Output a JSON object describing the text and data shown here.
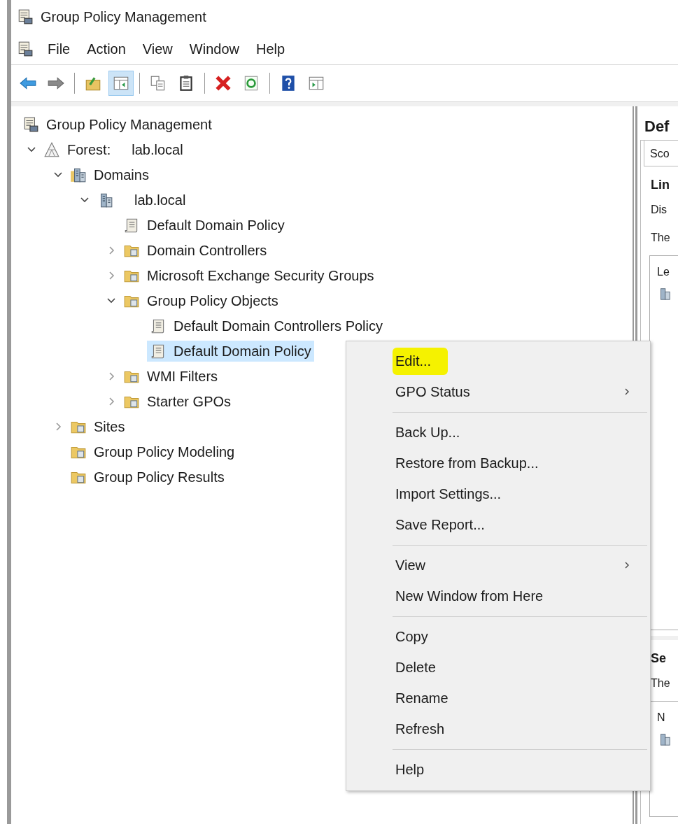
{
  "window": {
    "title": "Group Policy Management"
  },
  "menu_bar": [
    "File",
    "Action",
    "View",
    "Window",
    "Help"
  ],
  "toolbar": [
    {
      "kind": "back",
      "pressed": false
    },
    {
      "kind": "forward",
      "pressed": false
    },
    {
      "kind": "separator"
    },
    {
      "kind": "up",
      "pressed": false
    },
    {
      "kind": "tree-toggle",
      "pressed": true
    },
    {
      "kind": "separator"
    },
    {
      "kind": "copy",
      "pressed": false
    },
    {
      "kind": "paste",
      "pressed": false
    },
    {
      "kind": "separator"
    },
    {
      "kind": "delete",
      "pressed": false
    },
    {
      "kind": "refresh",
      "pressed": false
    },
    {
      "kind": "separator"
    },
    {
      "kind": "help",
      "pressed": false
    },
    {
      "kind": "action-pane",
      "pressed": false
    }
  ],
  "tree": [
    {
      "label": "Group Policy Management",
      "kind": "console",
      "selected": false,
      "children": [
        {
          "label": "Forest:",
          "name": "lab.local",
          "kind": "forest",
          "expanded": true,
          "selected": false,
          "children": [
            {
              "label": "Domains",
              "kind": "building",
              "expanded": true,
              "selected": false,
              "children": [
                {
                  "label": "lab.local",
                  "kind": "domain",
                  "expanded": true,
                  "selected": false,
                  "children": [
                    {
                      "label": "Default Domain Policy",
                      "kind": "scroll",
                      "selected": false
                    },
                    {
                      "label": "Domain Controllers",
                      "kind": "folder",
                      "expanded": false,
                      "selected": false
                    },
                    {
                      "label": "Microsoft Exchange Security Groups",
                      "kind": "folder",
                      "expanded": false,
                      "selected": false
                    },
                    {
                      "label": "Group Policy Objects",
                      "kind": "folder",
                      "expanded": true,
                      "selected": false,
                      "children": [
                        {
                          "label": "Default Domain Controllers Policy",
                          "kind": "scroll",
                          "selected": false
                        },
                        {
                          "label": "Default Domain Policy",
                          "kind": "scroll",
                          "selected": true
                        }
                      ]
                    },
                    {
                      "label": "WMI Filters",
                      "kind": "folder",
                      "expanded": false,
                      "selected": false
                    },
                    {
                      "label": "Starter GPOs",
                      "kind": "folder",
                      "expanded": false,
                      "selected": false
                    }
                  ]
                }
              ]
            },
            {
              "label": "Sites",
              "kind": "folder",
              "expanded": false,
              "selected": false
            },
            {
              "label": "Group Policy Modeling",
              "kind": "folder",
              "selected": false
            },
            {
              "label": "Group Policy Results",
              "kind": "folder",
              "selected": false
            }
          ]
        }
      ]
    }
  ],
  "right_pane": {
    "title": "Def",
    "tab": {
      "label": "Sco",
      "selected": true
    },
    "sections": [
      {
        "heading": "Lin",
        "lines": [
          "Dis",
          "The"
        ],
        "list_header": "Le"
      },
      {
        "heading": "Se",
        "lines": [
          "The"
        ],
        "list_header": "N"
      }
    ]
  },
  "context_menu": [
    [
      {
        "label": "Edit...",
        "submenu": false,
        "highlighted": true
      },
      {
        "label": "GPO Status",
        "submenu": true,
        "highlighted": false
      }
    ],
    [
      {
        "label": "Back Up...",
        "submenu": false,
        "highlighted": false
      },
      {
        "label": "Restore from Backup...",
        "submenu": false,
        "highlighted": false
      },
      {
        "label": "Import Settings...",
        "submenu": false,
        "highlighted": false
      },
      {
        "label": "Save Report...",
        "submenu": false,
        "highlighted": false
      }
    ],
    [
      {
        "label": "View",
        "submenu": true,
        "highlighted": false
      },
      {
        "label": "New Window from Here",
        "submenu": false,
        "highlighted": false
      }
    ],
    [
      {
        "label": "Copy",
        "submenu": false,
        "highlighted": false
      },
      {
        "label": "Delete",
        "submenu": false,
        "highlighted": false
      },
      {
        "label": "Rename",
        "submenu": false,
        "highlighted": false
      },
      {
        "label": "Refresh",
        "submenu": false,
        "highlighted": false
      }
    ],
    [
      {
        "label": "Help",
        "submenu": false,
        "highlighted": false
      }
    ]
  ]
}
